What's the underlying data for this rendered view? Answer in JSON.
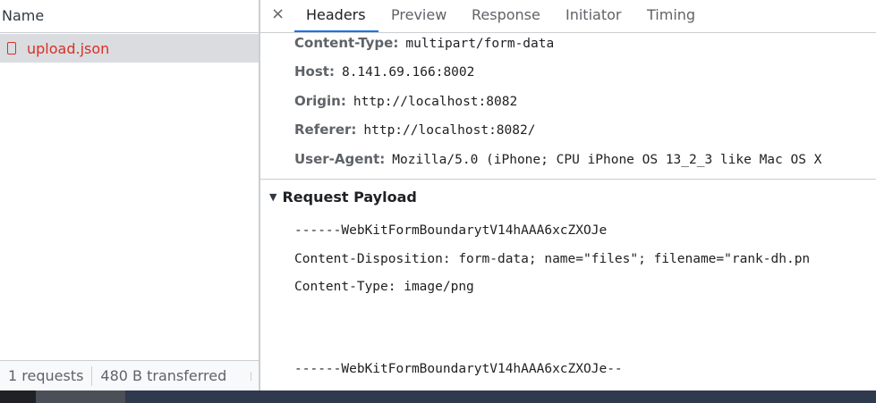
{
  "left": {
    "column_header": "Name",
    "request": {
      "name": "upload.json",
      "icon": "document-icon",
      "color": "#d93025"
    },
    "status": {
      "requests": "1 requests",
      "transferred": "480 B transferred"
    }
  },
  "tabs": {
    "close": "×",
    "items": [
      "Headers",
      "Preview",
      "Response",
      "Initiator",
      "Timing"
    ],
    "active": "Headers"
  },
  "headers": [
    {
      "key": "Content-Type:",
      "value": "multipart/form-data"
    },
    {
      "key": "Host:",
      "value": "8.141.69.166:8002"
    },
    {
      "key": "Origin:",
      "value": "http://localhost:8082"
    },
    {
      "key": "Referer:",
      "value": "http://localhost:8082/"
    },
    {
      "key": "User-Agent:",
      "value": "Mozilla/5.0 (iPhone; CPU iPhone OS 13_2_3 like Mac OS X"
    }
  ],
  "payload": {
    "title": "Request Payload",
    "lines": [
      "------WebKitFormBoundarytV14hAAA6xcZXOJe",
      "Content-Disposition: form-data; name=\"files\"; filename=\"rank-dh.pn",
      "Content-Type: image/png",
      "------WebKitFormBoundarytV14hAAA6xcZXOJe--"
    ]
  },
  "colors": {
    "accent": "#1a73e8",
    "error": "#d93025",
    "selected_row": "#dadce0"
  }
}
